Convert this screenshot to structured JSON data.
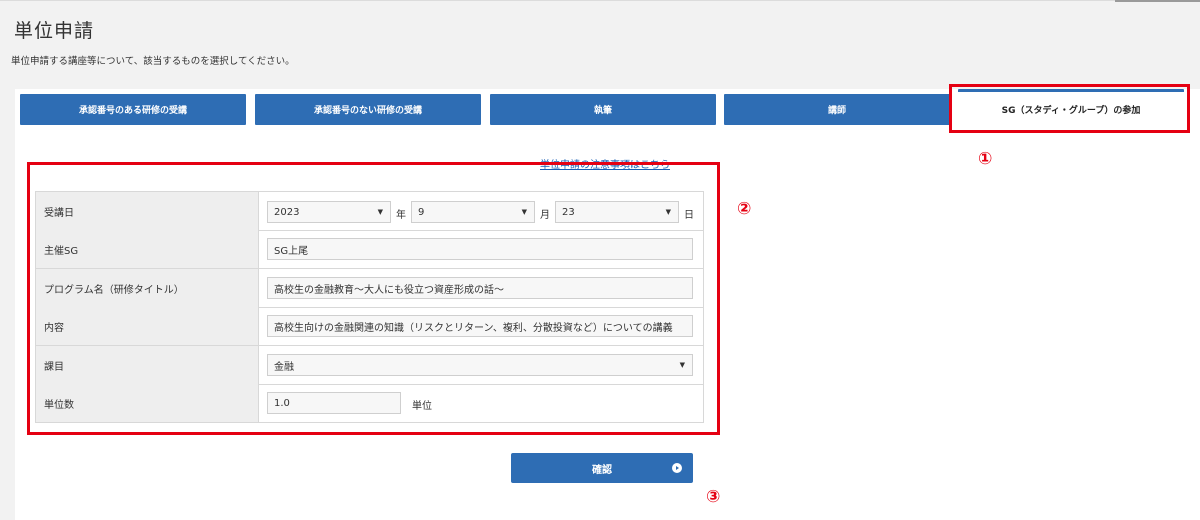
{
  "page": {
    "title": "単位申請",
    "description": "単位申請する講座等について、該当するものを選択してください。"
  },
  "tabs": [
    {
      "label": "承認番号のある研修の受講",
      "active": false
    },
    {
      "label": "承認番号のない研修の受講",
      "active": false
    },
    {
      "label": "執筆",
      "active": false
    },
    {
      "label": "講師",
      "active": false
    },
    {
      "label": "SG（スタディ・グループ）の参加",
      "active": true
    }
  ],
  "notice_link": "単位申請の注意事項はこちら",
  "annotations": {
    "one": "①",
    "two": "②",
    "three": "③"
  },
  "form": {
    "date": {
      "label": "受講日",
      "year": "2023",
      "year_unit": "年",
      "month": "9",
      "month_unit": "月",
      "day": "23",
      "day_unit": "日"
    },
    "host_sg": {
      "label": "主催SG",
      "value": "SG上尾"
    },
    "program": {
      "label": "プログラム名（研修タイトル）",
      "value": "高校生の金融教育～大人にも役立つ資産形成の話～"
    },
    "content": {
      "label": "内容",
      "value": "高校生向けの金融関連の知識（リスクとリターン、複利、分散投資など）についての講義"
    },
    "subject": {
      "label": "課目",
      "value": "金融"
    },
    "credits": {
      "label": "単位数",
      "value": "1.0",
      "unit": "単位"
    }
  },
  "confirm_button": "確認",
  "colors": {
    "accent": "#2e6db4",
    "highlight": "#e50012",
    "label_bg": "#eeeeee"
  }
}
